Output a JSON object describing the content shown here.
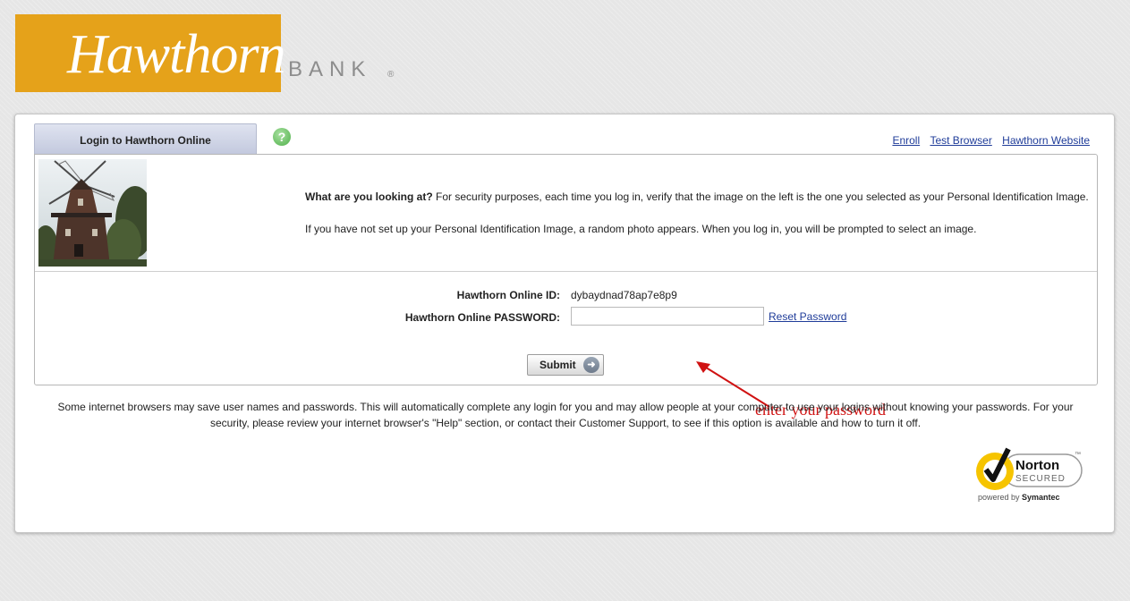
{
  "brand": {
    "script": "Hawthorn",
    "bank": "BANK",
    "registered": "®",
    "logo_color": "#e5a21a"
  },
  "tab": {
    "label": "Login to Hawthorn Online"
  },
  "help": {
    "icon": "question-icon",
    "glyph": "?"
  },
  "top_links": {
    "enroll": "Enroll",
    "test_browser": "Test Browser",
    "website": "Hawthorn Website"
  },
  "security": {
    "heading": "What are you looking at?",
    "line1": " For security purposes, each time you log in, verify that the image on the left is the one you selected as your Personal Identification Image.",
    "line2": "If you have not set up your Personal Identification Image, a random photo appears. When you log in, you will be prompted to select an image."
  },
  "form": {
    "id_label": "Hawthorn Online ID:",
    "id_value": "dybaydnad78ap7e8p9",
    "password_label": "Hawthorn Online PASSWORD:",
    "password_value": "",
    "reset_label": "Reset Password",
    "submit_label": "Submit"
  },
  "annotation": {
    "text": "enter your password",
    "color": "#d01212"
  },
  "disclaimer": "Some internet browsers may save user names and passwords. This will automatically complete any login for you and may allow people at your computer to use your logins without knowing your passwords. For your security, please review your internet browser's \"Help\" section, or contact their Customer Support, to see if this option is available and how to turn it off.",
  "norton": {
    "name": "Norton",
    "secured": "SECURED",
    "powered": "powered by ",
    "symantec": "Symantec",
    "tm": "™"
  }
}
